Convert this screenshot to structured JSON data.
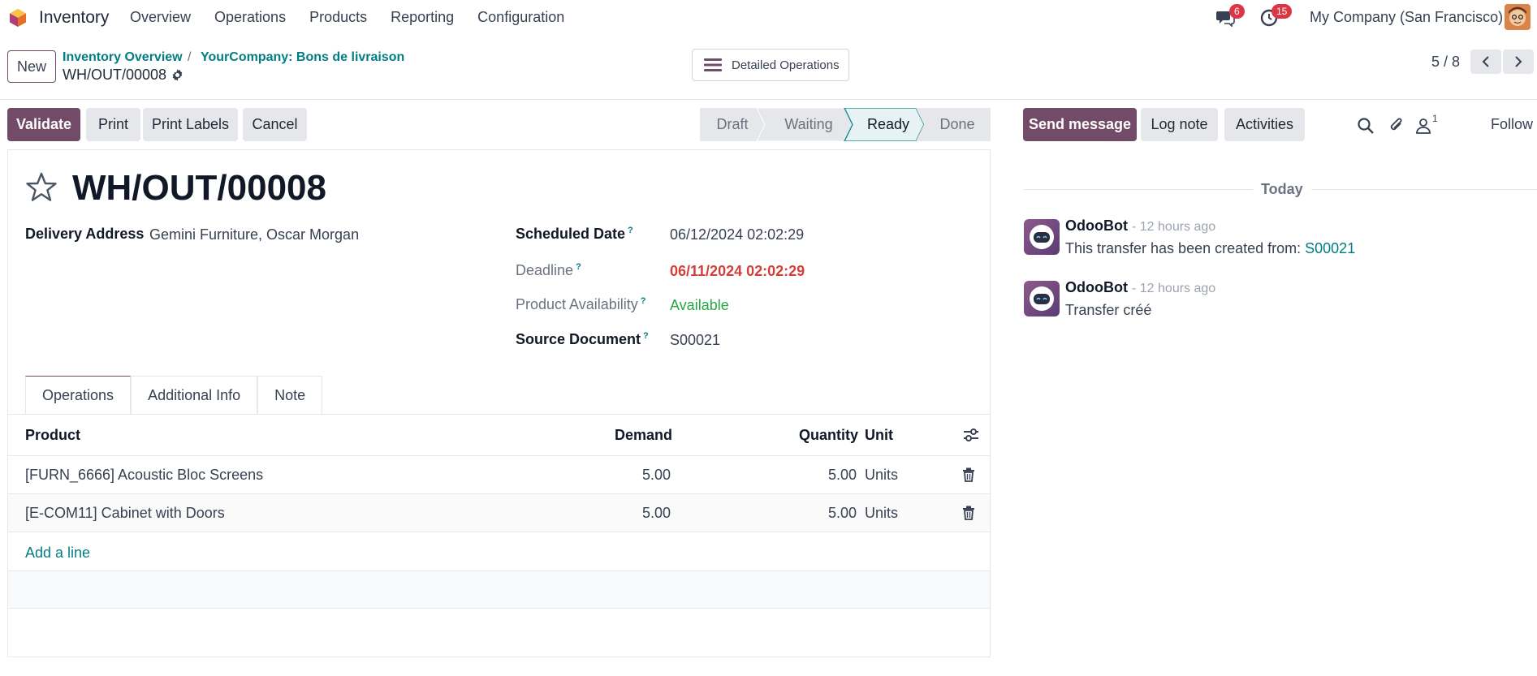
{
  "navbar": {
    "app_name": "Inventory",
    "menu": [
      "Overview",
      "Operations",
      "Products",
      "Reporting",
      "Configuration"
    ],
    "messages_badge": "6",
    "activities_badge": "15",
    "company": "My Company (San Francisco)"
  },
  "control_panel": {
    "new_label": "New",
    "breadcrumb": [
      "Inventory Overview",
      "YourCompany: Bons de livraison"
    ],
    "current": "WH/OUT/00008",
    "detailed_operations_label": "Detailed Operations",
    "pager": "5 / 8"
  },
  "actions": {
    "validate": "Validate",
    "print": "Print",
    "print_labels": "Print Labels",
    "cancel": "Cancel"
  },
  "stages": [
    "Draft",
    "Waiting",
    "Ready",
    "Done"
  ],
  "active_stage": "Ready",
  "record": {
    "title": "WH/OUT/00008",
    "delivery_address_label": "Delivery Address",
    "delivery_address": "Gemini Furniture, Oscar Morgan",
    "scheduled_date_label": "Scheduled Date",
    "scheduled_date": "06/12/2024 02:02:29",
    "deadline_label": "Deadline",
    "deadline": "06/11/2024 02:02:29",
    "availability_label": "Product Availability",
    "availability": "Available",
    "source_label": "Source Document",
    "source": "S00021",
    "help_mark": "?"
  },
  "tabs": [
    "Operations",
    "Additional Info",
    "Note"
  ],
  "table": {
    "headers": {
      "product": "Product",
      "demand": "Demand",
      "quantity": "Quantity",
      "unit": "Unit"
    },
    "rows": [
      {
        "product": "[FURN_6666] Acoustic Bloc Screens",
        "demand": "5.00",
        "quantity": "5.00",
        "unit": "Units"
      },
      {
        "product": "[E-COM11] Cabinet with Doors",
        "demand": "5.00",
        "quantity": "5.00",
        "unit": "Units"
      }
    ],
    "add_line": "Add a line"
  },
  "chatter": {
    "send_message": "Send message",
    "log_note": "Log note",
    "activities": "Activities",
    "followers_count": "1",
    "follow": "Follow",
    "date_separator": "Today",
    "messages": [
      {
        "author": "OdooBot",
        "time": "- 12 hours ago",
        "body": "This transfer has been created from: ",
        "link": "S00021"
      },
      {
        "author": "OdooBot",
        "time": "- 12 hours ago",
        "body": "Transfer créé",
        "link": ""
      }
    ]
  },
  "colors": {
    "primary": "#714b67",
    "link": "#017e84",
    "danger": "#d23f3a",
    "success": "#28a745"
  }
}
